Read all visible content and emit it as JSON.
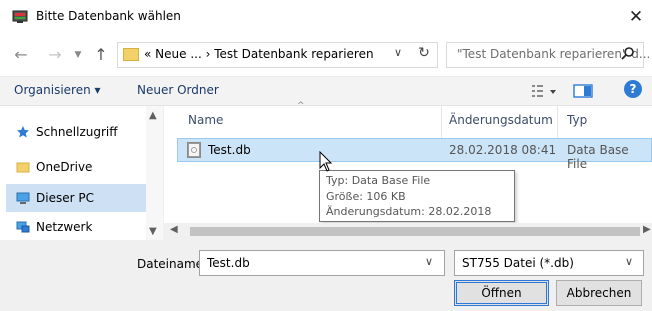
{
  "window": {
    "title": "Bitte Datenbank wählen",
    "close_glyph": "✕"
  },
  "address": {
    "path": "« Neue ... › Test Datenbank reparieren",
    "search_placeholder": "\"Test Datenbank reparieren\" d..."
  },
  "toolbar": {
    "organize_label": "Organisieren ▾",
    "new_folder_label": "Neuer Ordner",
    "help_label": "?"
  },
  "nav": {
    "items": [
      {
        "label": "Schnellzugriff",
        "icon": "star-icon"
      },
      {
        "label": "OneDrive",
        "icon": "folder-icon"
      },
      {
        "label": "Dieser PC",
        "icon": "computer-icon"
      },
      {
        "label": "Netzwerk",
        "icon": "network-icon"
      }
    ]
  },
  "columns": {
    "name": "Name",
    "date": "Änderungsdatum",
    "type": "Typ"
  },
  "files": [
    {
      "name": "Test.db",
      "date": "28.02.2018 08:41",
      "type": "Data Base File"
    }
  ],
  "tooltip": {
    "line1": "Typ: Data Base File",
    "line2": "Größe: 106 KB",
    "line3": "Änderungsdatum: 28.02.2018 08:41"
  },
  "bottom": {
    "filename_label": "Dateiname:",
    "filename_value": "Test.db",
    "filetype_value": "ST755 Datei (*.db)",
    "open_label": "Öffnen",
    "cancel_label": "Abbrechen"
  },
  "colors": {
    "selection": "#cce4f7",
    "accent": "#2e7bd6"
  }
}
